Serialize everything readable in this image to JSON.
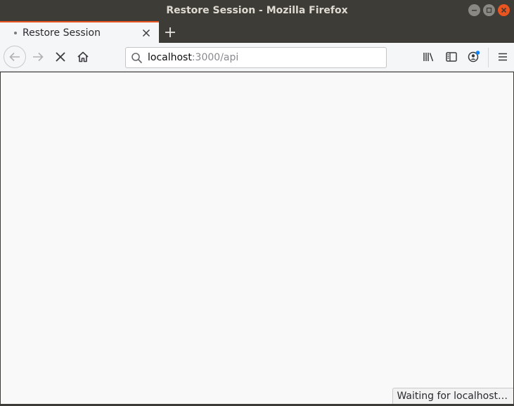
{
  "window": {
    "title": "Restore Session - Mozilla Firefox"
  },
  "tabs": [
    {
      "title": "Restore Session",
      "loading": true
    }
  ],
  "urlbar": {
    "host": "localhost",
    "rest": ":3000/api"
  },
  "status": {
    "text": "Waiting for localhost…"
  },
  "icons": {
    "back": "back-arrow-icon",
    "forward": "forward-arrow-icon",
    "stop": "stop-icon",
    "home": "home-icon",
    "search": "search-icon",
    "library": "library-icon",
    "sidebar": "sidebar-icon",
    "account": "account-icon",
    "menu": "hamburger-menu-icon"
  },
  "colors": {
    "accent": "#e95420",
    "account_badge": "#0a84ff"
  }
}
